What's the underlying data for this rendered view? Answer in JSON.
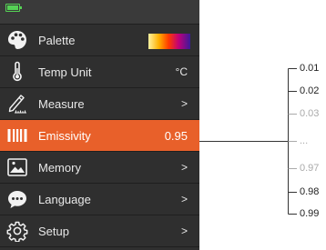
{
  "status": {
    "battery_level": 1.0,
    "battery_color": "#55d255"
  },
  "menu": {
    "items": [
      {
        "icon": "palette-icon",
        "label": "Palette",
        "value": "",
        "active": false
      },
      {
        "icon": "thermometer-icon",
        "label": "Temp Unit",
        "value": "°C",
        "active": false
      },
      {
        "icon": "measure-icon",
        "label": "Measure",
        "value": ">",
        "active": false
      },
      {
        "icon": "emissivity-icon",
        "label": "Emissivity",
        "value": "0.95",
        "active": true
      },
      {
        "icon": "memory-icon",
        "label": "Memory",
        "value": ">",
        "active": false
      },
      {
        "icon": "language-icon",
        "label": "Language",
        "value": ">",
        "active": false
      },
      {
        "icon": "gear-icon",
        "label": "Setup",
        "value": ">",
        "active": false
      }
    ]
  },
  "emissivity_options": {
    "items": [
      {
        "label": "0.01",
        "dim": false
      },
      {
        "label": "0.02",
        "dim": false
      },
      {
        "label": "0.03",
        "dim": true
      },
      {
        "label": "...",
        "dim": true
      },
      {
        "label": "0.97",
        "dim": true
      },
      {
        "label": "0.98",
        "dim": false
      },
      {
        "label": "0.99",
        "dim": false
      }
    ]
  },
  "colors": {
    "panel_bg": "#2f2f2f",
    "active_bg": "#e8602a",
    "text_light": "#e8e8e8",
    "option_text": "#222222",
    "option_dim": "#aaaaaa"
  }
}
